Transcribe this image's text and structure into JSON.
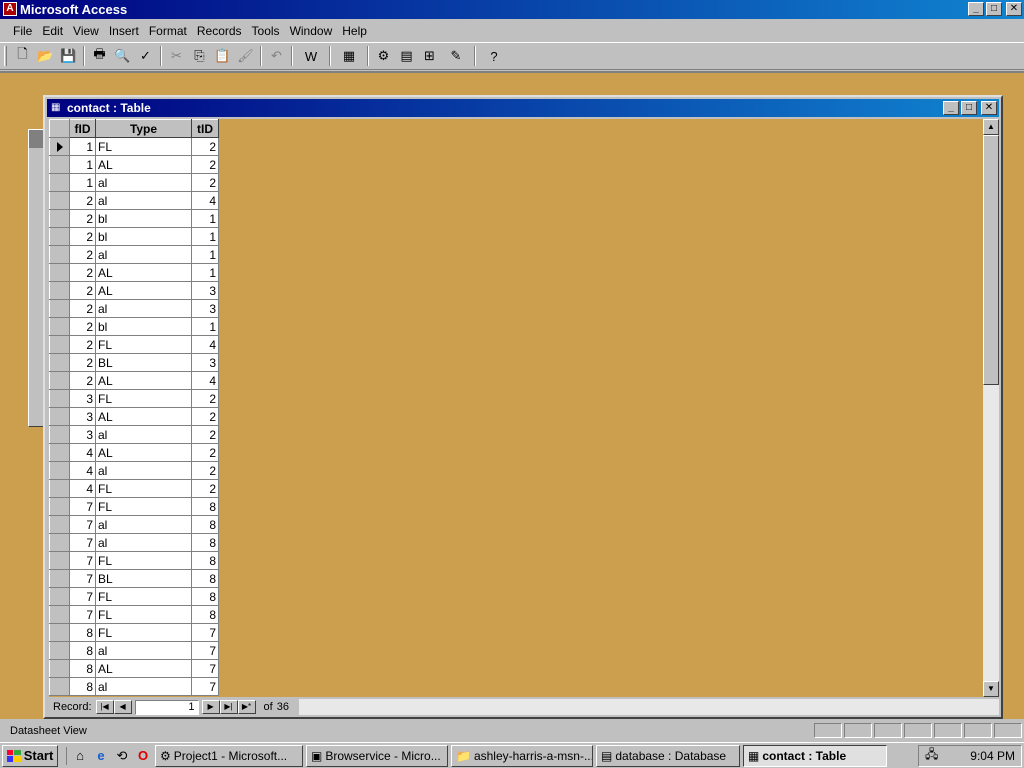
{
  "app": {
    "title": "Microsoft Access",
    "controls": {
      "minimize": "_",
      "maximize": "□",
      "close": "✕"
    }
  },
  "menubar": {
    "items": [
      {
        "label": "File",
        "hotkey": "F"
      },
      {
        "label": "Edit",
        "hotkey": "E"
      },
      {
        "label": "View",
        "hotkey": "V"
      },
      {
        "label": "Insert",
        "hotkey": "I"
      },
      {
        "label": "Format",
        "hotkey": "o"
      },
      {
        "label": "Records",
        "hotkey": "R"
      },
      {
        "label": "Tools",
        "hotkey": "T"
      },
      {
        "label": "Window",
        "hotkey": "W"
      },
      {
        "label": "Help",
        "hotkey": "H"
      }
    ]
  },
  "toolbar": {
    "icons": {
      "new": "🗋",
      "open": "📂",
      "save": "💾",
      "print": "🖶",
      "preview": "🔍",
      "spell": "✓",
      "cut": "✂",
      "copy": "⎘",
      "paste": "📋",
      "format_painter": "🖌",
      "undo": "↶",
      "office_links": "W",
      "analyze": "▦",
      "code": "⚙",
      "properties": "▤",
      "relationships": "⊞",
      "new_object": "✎",
      "help": "?"
    }
  },
  "table_window": {
    "title": "contact : Table",
    "columns": [
      "fID",
      "Type",
      "tID"
    ],
    "rows": [
      [
        "1",
        "FL",
        "2"
      ],
      [
        "1",
        "AL",
        "2"
      ],
      [
        "1",
        "al",
        "2"
      ],
      [
        "2",
        "al",
        "4"
      ],
      [
        "2",
        "bl",
        "1"
      ],
      [
        "2",
        "bl",
        "1"
      ],
      [
        "2",
        "al",
        "1"
      ],
      [
        "2",
        "AL",
        "1"
      ],
      [
        "2",
        "AL",
        "3"
      ],
      [
        "2",
        "al",
        "3"
      ],
      [
        "2",
        "bl",
        "1"
      ],
      [
        "2",
        "FL",
        "4"
      ],
      [
        "2",
        "BL",
        "3"
      ],
      [
        "2",
        "AL",
        "4"
      ],
      [
        "3",
        "FL",
        "2"
      ],
      [
        "3",
        "AL",
        "2"
      ],
      [
        "3",
        "al",
        "2"
      ],
      [
        "4",
        "AL",
        "2"
      ],
      [
        "4",
        "al",
        "2"
      ],
      [
        "4",
        "FL",
        "2"
      ],
      [
        "7",
        "FL",
        "8"
      ],
      [
        "7",
        "al",
        "8"
      ],
      [
        "7",
        "al",
        "8"
      ],
      [
        "7",
        "FL",
        "8"
      ],
      [
        "7",
        "BL",
        "8"
      ],
      [
        "7",
        "FL",
        "8"
      ],
      [
        "7",
        "FL",
        "8"
      ],
      [
        "8",
        "FL",
        "7"
      ],
      [
        "8",
        "al",
        "7"
      ],
      [
        "8",
        "AL",
        "7"
      ],
      [
        "8",
        "al",
        "7"
      ]
    ],
    "navigator": {
      "label": "Record:",
      "current": "1",
      "of_label": "of",
      "total": "36"
    }
  },
  "statusbar": {
    "text": "Datasheet View"
  },
  "taskbar": {
    "start_label": "Start",
    "buttons": [
      {
        "label": "Project1 - Microsoft...",
        "icon": "⚙",
        "active": false
      },
      {
        "label": "Browservice - Micro...",
        "icon": "▣",
        "active": false
      },
      {
        "label": "ashley-harris-a-msn-...",
        "icon": "📁",
        "active": false
      },
      {
        "label": "database : Database",
        "icon": "▤",
        "active": false
      },
      {
        "label": "contact : Table",
        "icon": "▦",
        "active": true
      }
    ],
    "clock": "9:04 PM"
  }
}
